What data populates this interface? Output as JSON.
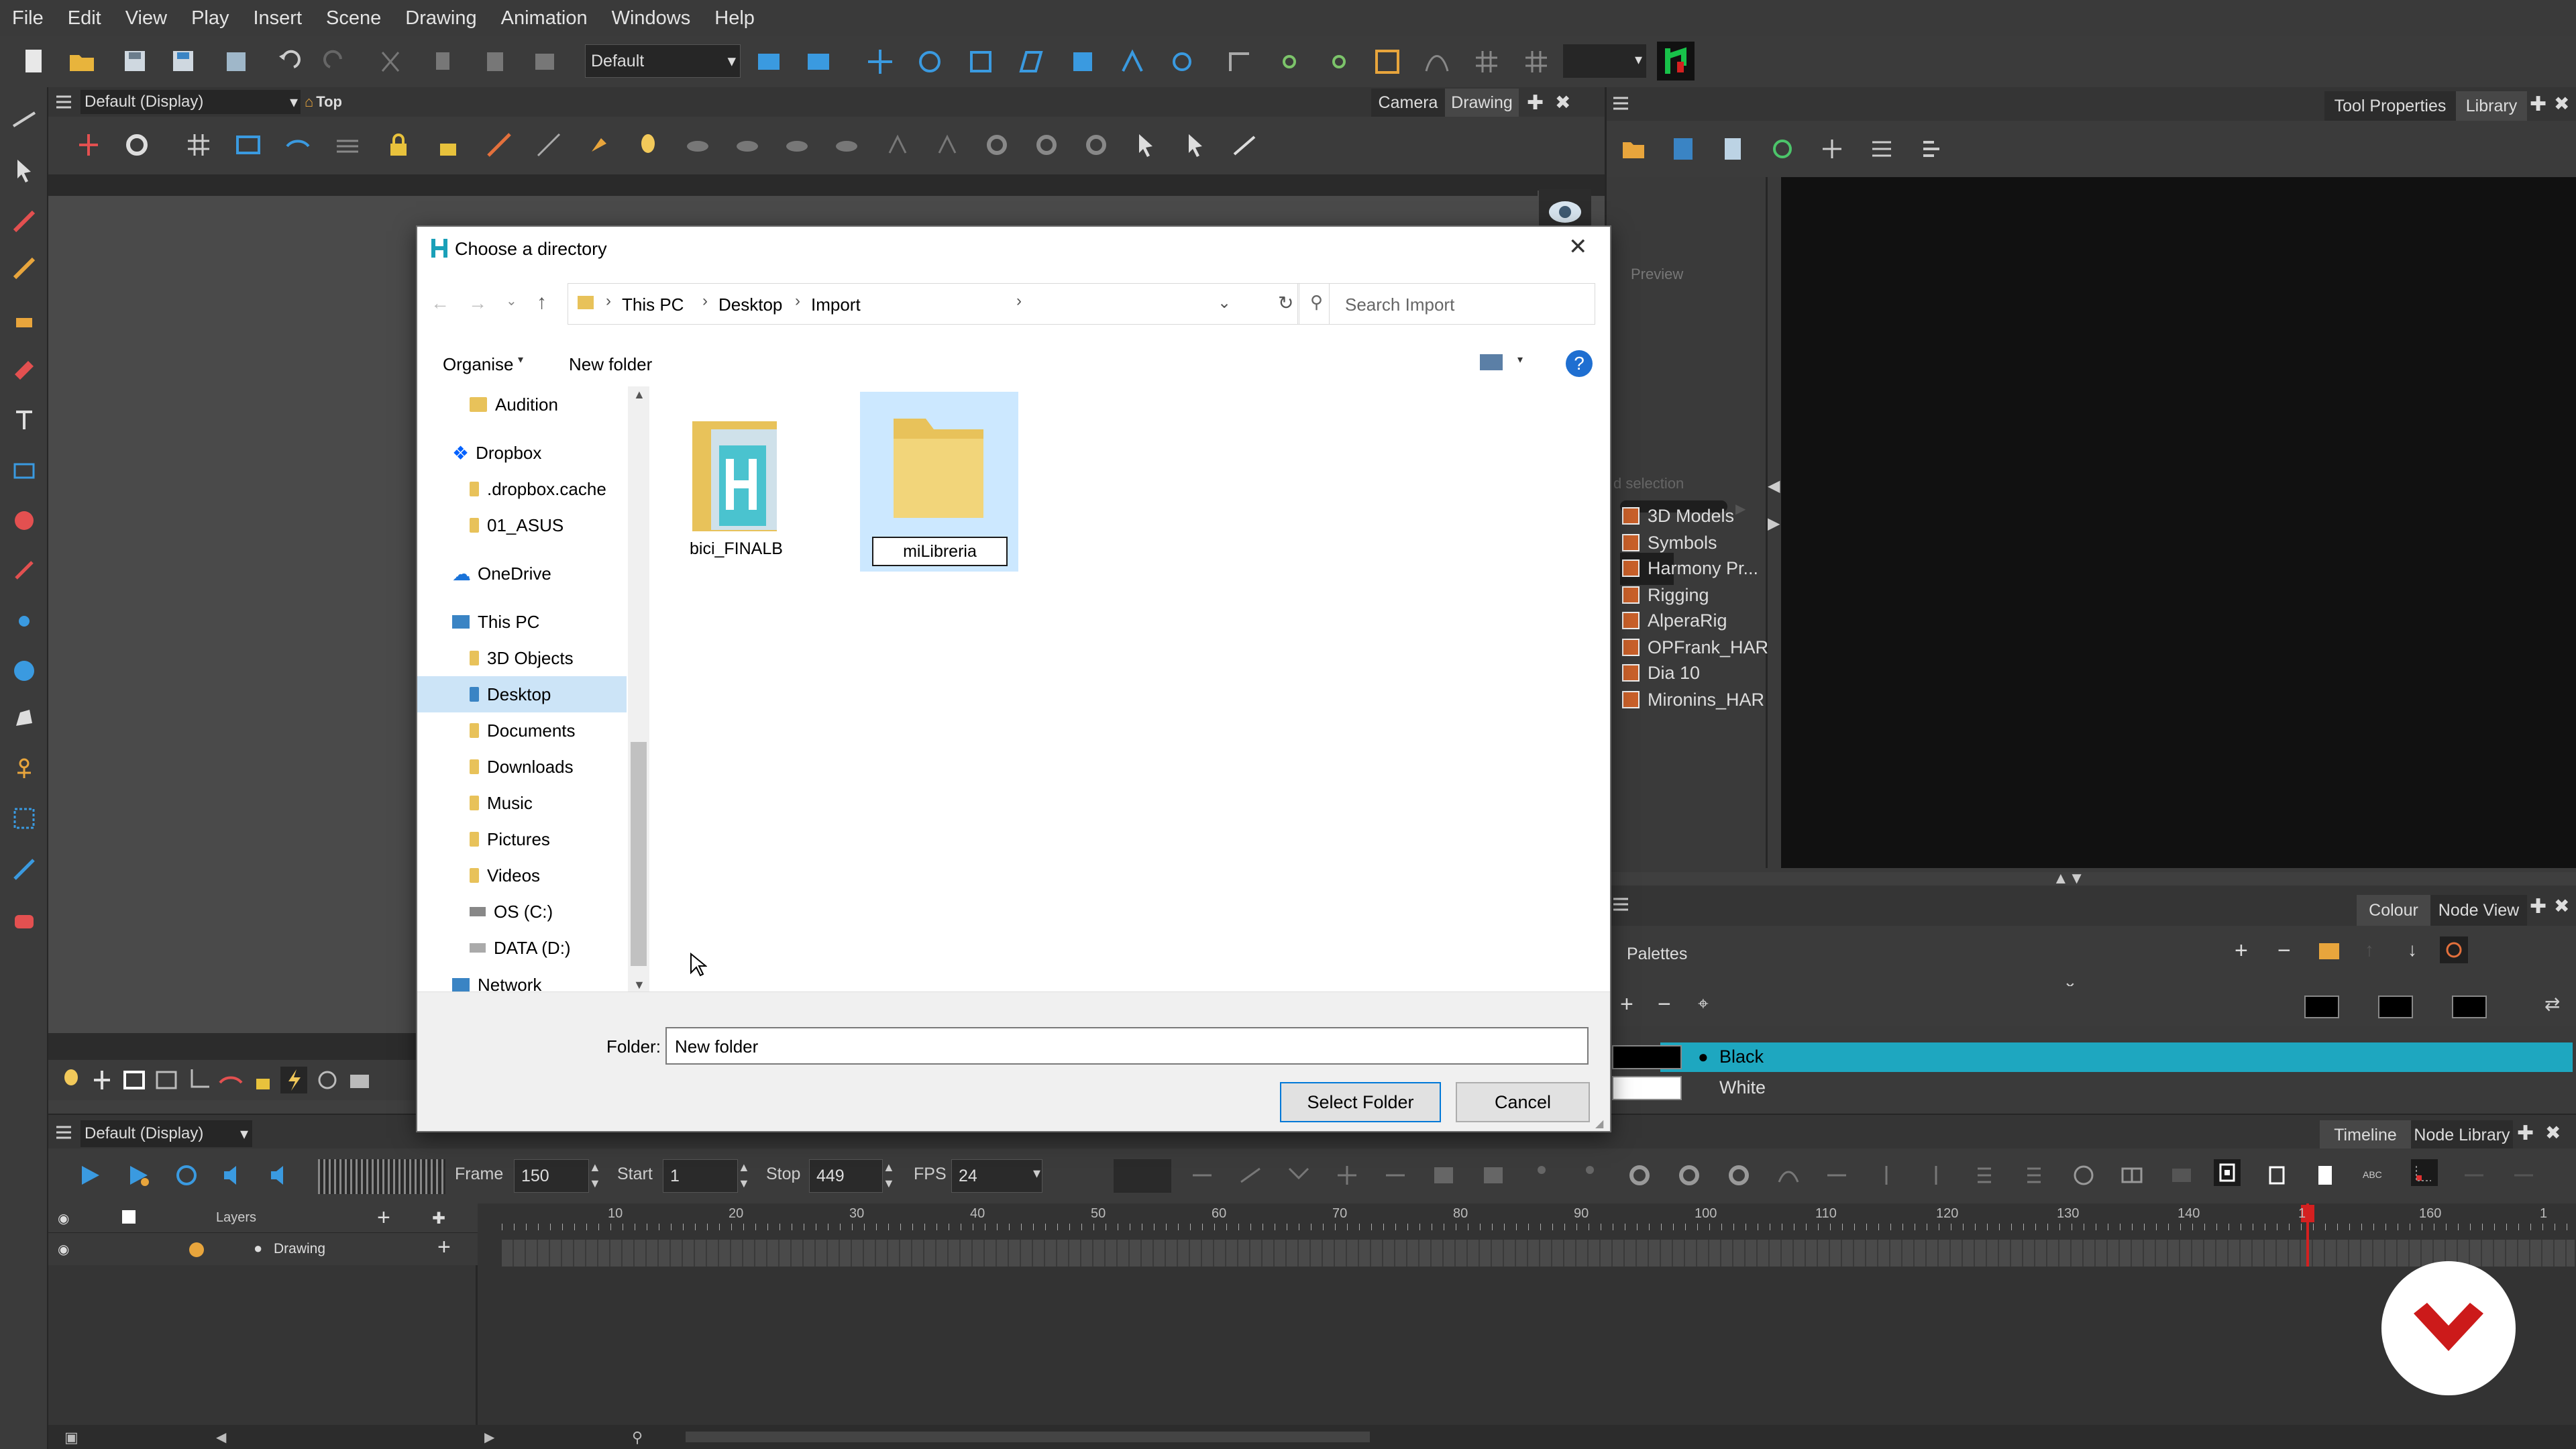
{
  "menu": [
    "File",
    "Edit",
    "View",
    "Play",
    "Insert",
    "Scene",
    "Drawing",
    "Animation",
    "Windows",
    "Help"
  ],
  "toolbar": {
    "view_preset": "Default"
  },
  "camera_view": {
    "display_select": "Default (Display)",
    "view_label": "Top",
    "tabs": [
      "Camera",
      "Drawing"
    ]
  },
  "right_panel": {
    "tabs": [
      "Tool Properties",
      "Library"
    ],
    "preview_label": "Preview",
    "selection_hint": "d selection",
    "library_items": [
      "3D Models",
      "Symbols",
      "Harmony Pr...",
      "Rigging",
      "AlperaRig",
      "OPFrank_HAR",
      "Dia 10",
      "Mironins_HAR"
    ]
  },
  "colour_panel": {
    "tabs": [
      "Colour",
      "Node View"
    ],
    "palettes_label": "Palettes",
    "swatches": [
      {
        "name": "Black",
        "color": "#000000",
        "selected": true
      },
      {
        "name": "White",
        "color": "#ffffff",
        "selected": false
      }
    ],
    "selected_row_color": "#1ea7c0"
  },
  "timeline": {
    "display_select": "Default (Display)",
    "tabs": [
      "Timeline",
      "Node Library"
    ],
    "frame_label": "Frame",
    "frame_value": "150",
    "start_label": "Start",
    "start_value": "1",
    "stop_label": "Stop",
    "stop_value": "449",
    "fps_label": "FPS",
    "fps_value": "24",
    "layers_header": "Layers",
    "layer_name": "Drawing",
    "ticks": [
      "10",
      "20",
      "30",
      "40",
      "50",
      "60",
      "70",
      "80",
      "90",
      "100",
      "110",
      "120",
      "130",
      "140",
      "1",
      "160",
      "1"
    ],
    "current_frame": 150
  },
  "dialog": {
    "title": "Choose a directory",
    "breadcrumb": [
      "This PC",
      "Desktop",
      "Import"
    ],
    "search_placeholder": "Search Import",
    "organise_label": "Organise",
    "new_folder_label": "New folder",
    "nav": {
      "audition": "Audition",
      "dropbox": "Dropbox",
      "dropbox_cache": ".dropbox.cache",
      "asus": "01_ASUS",
      "onedrive": "OneDrive",
      "this_pc": "This PC",
      "objects3d": "3D Objects",
      "desktop": "Desktop",
      "documents": "Documents",
      "downloads": "Downloads",
      "music": "Music",
      "pictures": "Pictures",
      "videos": "Videos",
      "os_c": "OS (C:)",
      "data_d": "DATA (D:)",
      "network": "Network"
    },
    "files": [
      {
        "name": "bici_FINALB",
        "selected": false
      },
      {
        "name": "miLibreria",
        "selected": true,
        "editing": true
      }
    ],
    "folder_label": "Folder:",
    "folder_value": "New folder",
    "select_button": "Select Folder",
    "cancel_button": "Cancel"
  },
  "colors": {
    "accent": "#1ea7c0",
    "brand_logo": "#cc1a1a",
    "playhead": "#d42020"
  }
}
